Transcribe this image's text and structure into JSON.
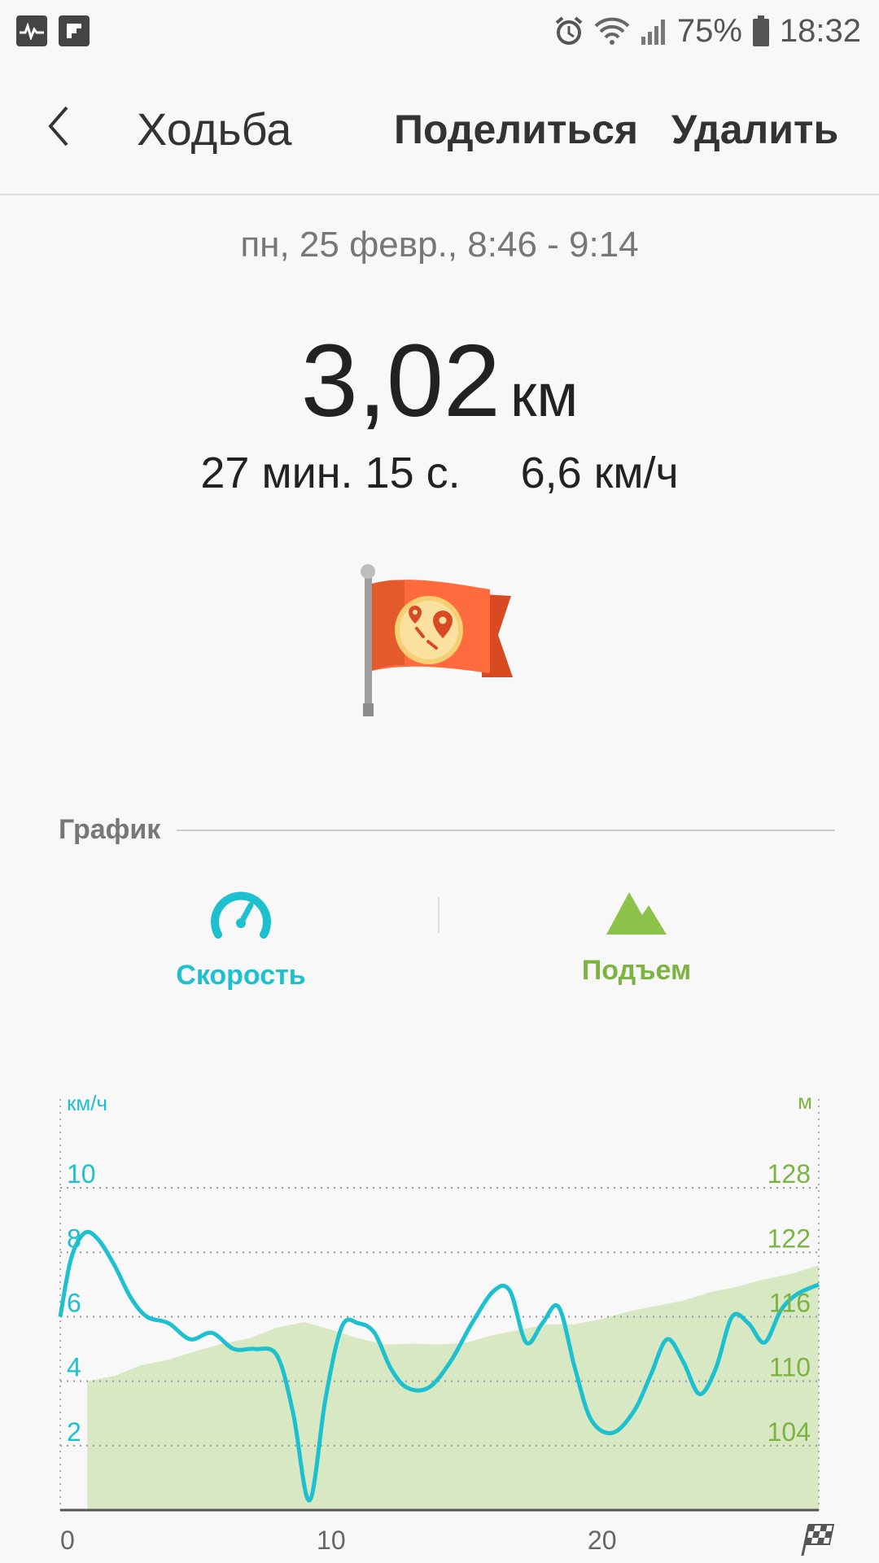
{
  "status_bar": {
    "battery": "75%",
    "time": "18:32",
    "icons": [
      "activity-icon",
      "flipboard-icon",
      "alarm-icon",
      "wifi-icon",
      "signal-icon",
      "battery-icon"
    ]
  },
  "app_bar": {
    "title": "Ходьба",
    "share_label": "Поделиться",
    "delete_label": "Удалить",
    "back_icon": "chevron-left-icon"
  },
  "workout": {
    "date_range": "пн, 25 февр., 8:46 - 9:14",
    "distance_value": "3,02",
    "distance_unit": "км",
    "duration": "27 мин. 15 с.",
    "avg_speed": "6,6 км/ч",
    "badge_icon": "route-flag-icon"
  },
  "graph_section": {
    "title": "График",
    "tabs": [
      {
        "label": "Скорость",
        "icon": "speedometer-icon",
        "color": "#1cc0cf"
      },
      {
        "label": "Подъем",
        "icon": "mountain-icon",
        "color": "#7cb342"
      }
    ]
  },
  "chart_data": {
    "type": "line",
    "left_axis": {
      "unit": "км/ч",
      "ticks": [
        2,
        4,
        6,
        8,
        10
      ],
      "range": [
        0,
        12
      ],
      "color": "#1cc0cf"
    },
    "right_axis": {
      "unit": "м",
      "ticks": [
        104,
        110,
        116,
        122,
        128
      ],
      "range": [
        98,
        134
      ],
      "color": "#7cb342"
    },
    "x_axis": {
      "ticks": [
        "0",
        "10",
        "20"
      ],
      "range": [
        0,
        28
      ],
      "end_icon": "finish-flag-icon"
    },
    "series": [
      {
        "kind": "line",
        "axis": "left",
        "color": "#1cc0cf",
        "points": [
          [
            0,
            6.0
          ],
          [
            0.4,
            7.8
          ],
          [
            0.9,
            8.6
          ],
          [
            1.4,
            8.4
          ],
          [
            2.0,
            7.6
          ],
          [
            2.6,
            6.6
          ],
          [
            3.2,
            6.0
          ],
          [
            4.0,
            5.8
          ],
          [
            4.8,
            5.3
          ],
          [
            5.6,
            5.5
          ],
          [
            6.4,
            5.0
          ],
          [
            7.2,
            5.0
          ],
          [
            8.0,
            4.8
          ],
          [
            8.6,
            3.0
          ],
          [
            9.2,
            0.3
          ],
          [
            9.8,
            3.5
          ],
          [
            10.4,
            5.7
          ],
          [
            11.0,
            5.8
          ],
          [
            11.6,
            5.5
          ],
          [
            12.2,
            4.4
          ],
          [
            12.8,
            3.8
          ],
          [
            13.6,
            3.8
          ],
          [
            14.4,
            4.6
          ],
          [
            15.2,
            5.8
          ],
          [
            16.0,
            6.8
          ],
          [
            16.6,
            6.8
          ],
          [
            17.2,
            5.2
          ],
          [
            17.8,
            5.8
          ],
          [
            18.4,
            6.3
          ],
          [
            19.0,
            4.4
          ],
          [
            19.6,
            2.8
          ],
          [
            20.4,
            2.4
          ],
          [
            21.2,
            3.1
          ],
          [
            21.8,
            4.2
          ],
          [
            22.4,
            5.3
          ],
          [
            23.0,
            4.6
          ],
          [
            23.6,
            3.6
          ],
          [
            24.2,
            4.4
          ],
          [
            24.8,
            6.0
          ],
          [
            25.4,
            5.8
          ],
          [
            26.0,
            5.2
          ],
          [
            26.6,
            6.2
          ],
          [
            27.2,
            6.7
          ],
          [
            28.0,
            7.0
          ]
        ]
      },
      {
        "kind": "area",
        "axis": "right",
        "color": "#d7e8c3",
        "points": [
          [
            1.0,
            110.0
          ],
          [
            2.0,
            110.5
          ],
          [
            3.0,
            111.5
          ],
          [
            4.0,
            112.0
          ],
          [
            5.0,
            112.8
          ],
          [
            6.0,
            113.5
          ],
          [
            7.0,
            114.0
          ],
          [
            8.0,
            115.0
          ],
          [
            9.0,
            115.5
          ],
          [
            10.0,
            114.8
          ],
          [
            11.0,
            114.0
          ],
          [
            12.0,
            113.4
          ],
          [
            13.0,
            113.5
          ],
          [
            14.0,
            113.4
          ],
          [
            15.0,
            113.6
          ],
          [
            16.0,
            114.3
          ],
          [
            17.0,
            114.8
          ],
          [
            18.0,
            115.3
          ],
          [
            19.0,
            115.3
          ],
          [
            20.0,
            115.8
          ],
          [
            21.0,
            116.5
          ],
          [
            22.0,
            117.0
          ],
          [
            23.0,
            117.5
          ],
          [
            24.0,
            118.3
          ],
          [
            25.0,
            118.8
          ],
          [
            26.0,
            119.5
          ],
          [
            27.0,
            120.0
          ],
          [
            28.0,
            120.8
          ]
        ]
      }
    ]
  }
}
